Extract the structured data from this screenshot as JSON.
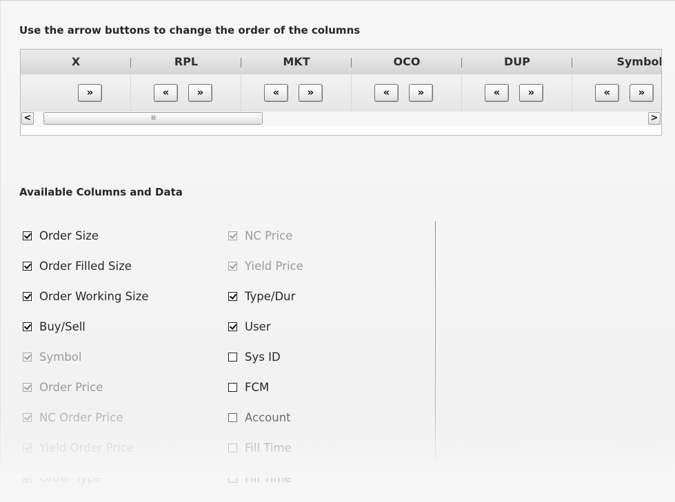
{
  "reorder": {
    "title": "Use the arrow buttons to change the order of the columns",
    "columns": [
      {
        "label": "X",
        "left": "",
        "right": "»"
      },
      {
        "label": "RPL",
        "left": "«",
        "right": "»"
      },
      {
        "label": "MKT",
        "left": "«",
        "right": "»"
      },
      {
        "label": "OCO",
        "left": "«",
        "right": "»"
      },
      {
        "label": "DUP",
        "left": "«",
        "right": "»"
      },
      {
        "label": "Symbol",
        "left": "«",
        "right": "»"
      }
    ],
    "scrollbar": {
      "left_arrow": "<",
      "right_arrow": ">",
      "thumb_grip": "IIII",
      "position": 0.0
    }
  },
  "available": {
    "title": "Available Columns and Data",
    "left_items": [
      {
        "label": "Order Size",
        "checked": true,
        "enabled": true
      },
      {
        "label": "Order Filled Size",
        "checked": true,
        "enabled": true
      },
      {
        "label": "Order Working Size",
        "checked": true,
        "enabled": true
      },
      {
        "label": "Buy/Sell",
        "checked": true,
        "enabled": true
      },
      {
        "label": "Symbol",
        "checked": true,
        "enabled": false
      },
      {
        "label": "Order Price",
        "checked": true,
        "enabled": false
      },
      {
        "label": "NC Order Price",
        "checked": true,
        "enabled": false
      },
      {
        "label": "Yield Order Price",
        "checked": true,
        "enabled": false
      },
      {
        "label": "Order Type",
        "checked": true,
        "enabled": false
      }
    ],
    "right_items": [
      {
        "label": "NC Price",
        "checked": true,
        "enabled": false
      },
      {
        "label": "Yield Price",
        "checked": true,
        "enabled": false
      },
      {
        "label": "Type/Dur",
        "checked": true,
        "enabled": true
      },
      {
        "label": "User",
        "checked": true,
        "enabled": true
      },
      {
        "label": "Sys ID",
        "checked": false,
        "enabled": true
      },
      {
        "label": "FCM",
        "checked": false,
        "enabled": true
      },
      {
        "label": "Account",
        "checked": false,
        "enabled": true
      },
      {
        "label": "Fill Time",
        "checked": false,
        "enabled": true
      },
      {
        "label": "Fill Time",
        "checked": false,
        "enabled": true
      }
    ]
  }
}
